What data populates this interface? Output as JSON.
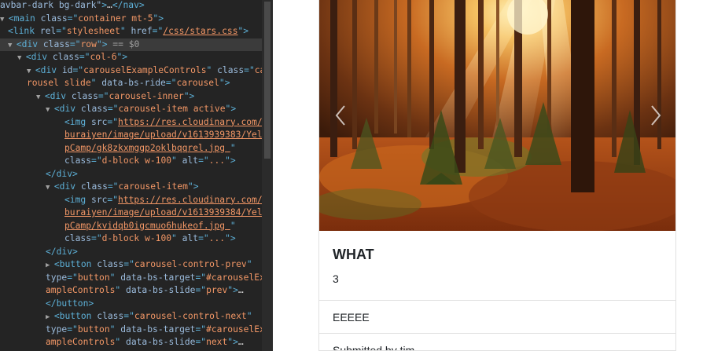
{
  "devtools": {
    "lines": [
      {
        "tokens": [
          [
            "attr",
            "avbar-dark bg-dark\""
          ],
          [
            "tag",
            ">"
          ],
          [
            "txt",
            "…"
          ],
          [
            "tag",
            "</nav>"
          ]
        ]
      },
      {
        "tri": "▼",
        "tokens": [
          [
            "tag",
            "<main "
          ],
          [
            "attr",
            "class"
          ],
          [
            "tag",
            "=\""
          ],
          [
            "val",
            "container mt-5"
          ],
          [
            "tag",
            "\">"
          ]
        ]
      },
      {
        "tokens": [
          [
            "tag",
            "<link "
          ],
          [
            "attr",
            "rel"
          ],
          [
            "tag",
            "=\""
          ],
          [
            "val",
            "stylesheet"
          ],
          [
            "tag",
            "\" "
          ],
          [
            "attr",
            "href"
          ],
          [
            "tag",
            "=\""
          ],
          [
            "link",
            "/css/stars.css"
          ],
          [
            "tag",
            "\">"
          ]
        ]
      },
      {
        "tri": "▼",
        "selected": true,
        "tokens": [
          [
            "tag",
            "<div "
          ],
          [
            "attr",
            "class"
          ],
          [
            "tag",
            "=\""
          ],
          [
            "val",
            "row"
          ],
          [
            "tag",
            "\">"
          ],
          [
            "dim",
            " == $0"
          ]
        ]
      },
      {
        "tri": "▼",
        "tokens": [
          [
            "tag",
            "<div "
          ],
          [
            "attr",
            "class"
          ],
          [
            "tag",
            "=\""
          ],
          [
            "val",
            "col-6"
          ],
          [
            "tag",
            "\">"
          ]
        ]
      },
      {
        "tri": "▼",
        "tokens": [
          [
            "tag",
            "<div "
          ],
          [
            "attr",
            "id"
          ],
          [
            "tag",
            "=\""
          ],
          [
            "val",
            "carouselExampleControls"
          ],
          [
            "tag",
            "\" "
          ],
          [
            "attr",
            "class"
          ],
          [
            "tag",
            "=\""
          ],
          [
            "val",
            "ca"
          ]
        ]
      },
      {
        "tokens": [
          [
            "val",
            "rousel slide"
          ],
          [
            "tag",
            "\" "
          ],
          [
            "attr",
            "data-bs-ride"
          ],
          [
            "tag",
            "=\""
          ],
          [
            "val",
            "carousel"
          ],
          [
            "tag",
            "\">"
          ]
        ]
      },
      {
        "tri": "▼",
        "tokens": [
          [
            "tag",
            "<div "
          ],
          [
            "attr",
            "class"
          ],
          [
            "tag",
            "=\""
          ],
          [
            "val",
            "carousel-inner"
          ],
          [
            "tag",
            "\">"
          ]
        ]
      },
      {
        "tri": "▼",
        "tokens": [
          [
            "tag",
            "<div "
          ],
          [
            "attr",
            "class"
          ],
          [
            "tag",
            "=\""
          ],
          [
            "val",
            "carousel-item active"
          ],
          [
            "tag",
            "\">"
          ]
        ]
      },
      {
        "tokens": [
          [
            "tag",
            "<img "
          ],
          [
            "attr",
            "src"
          ],
          [
            "tag",
            "=\""
          ],
          [
            "link",
            "https://res.cloudinary.com/"
          ]
        ]
      },
      {
        "tokens": [
          [
            "link",
            "buraiyen/image/upload/v1613939383/Yel"
          ]
        ]
      },
      {
        "tokens": [
          [
            "link",
            "pCamp/gk8zkxmggp2oklbqqrel.jpg "
          ],
          [
            "tag",
            "\""
          ]
        ]
      },
      {
        "tokens": [
          [
            "attr",
            "class"
          ],
          [
            "tag",
            "=\""
          ],
          [
            "val",
            "d-block w-100"
          ],
          [
            "tag",
            "\" "
          ],
          [
            "attr",
            "alt"
          ],
          [
            "tag",
            "=\""
          ],
          [
            "val",
            "..."
          ],
          [
            "tag",
            "\">"
          ]
        ]
      },
      {
        "tokens": [
          [
            "tag",
            "</div>"
          ]
        ]
      },
      {
        "tri": "▼",
        "tokens": [
          [
            "tag",
            "<div "
          ],
          [
            "attr",
            "class"
          ],
          [
            "tag",
            "=\""
          ],
          [
            "val",
            "carousel-item"
          ],
          [
            "tag",
            "\">"
          ]
        ]
      },
      {
        "tokens": [
          [
            "tag",
            "<img "
          ],
          [
            "attr",
            "src"
          ],
          [
            "tag",
            "=\""
          ],
          [
            "link",
            "https://res.cloudinary.com/"
          ]
        ]
      },
      {
        "tokens": [
          [
            "link",
            "buraiyen/image/upload/v1613939384/Yel"
          ]
        ]
      },
      {
        "tokens": [
          [
            "link",
            "pCamp/kvidqb0igcmuo6hukeof.jpg "
          ],
          [
            "tag",
            "\""
          ]
        ]
      },
      {
        "tokens": [
          [
            "attr",
            "class"
          ],
          [
            "tag",
            "=\""
          ],
          [
            "val",
            "d-block w-100"
          ],
          [
            "tag",
            "\" "
          ],
          [
            "attr",
            "alt"
          ],
          [
            "tag",
            "=\""
          ],
          [
            "val",
            "..."
          ],
          [
            "tag",
            "\">"
          ]
        ]
      },
      {
        "tokens": [
          [
            "tag",
            "</div>"
          ]
        ]
      },
      {
        "tri": "▶",
        "tokens": [
          [
            "tag",
            "<button "
          ],
          [
            "attr",
            "class"
          ],
          [
            "tag",
            "=\""
          ],
          [
            "val",
            "carousel-control-prev"
          ],
          [
            "tag",
            "\""
          ]
        ]
      },
      {
        "tokens": [
          [
            "attr",
            "type"
          ],
          [
            "tag",
            "=\""
          ],
          [
            "val",
            "button"
          ],
          [
            "tag",
            "\" "
          ],
          [
            "attr",
            "data-bs-target"
          ],
          [
            "tag",
            "=\""
          ],
          [
            "val",
            "#carouselEx"
          ]
        ]
      },
      {
        "tokens": [
          [
            "val",
            "ampleControls"
          ],
          [
            "tag",
            "\" "
          ],
          [
            "attr",
            "data-bs-slide"
          ],
          [
            "tag",
            "=\""
          ],
          [
            "val",
            "prev"
          ],
          [
            "tag",
            "\">"
          ],
          [
            "txt",
            "…"
          ]
        ]
      },
      {
        "tokens": [
          [
            "tag",
            "</button>"
          ]
        ]
      },
      {
        "tri": "▶",
        "tokens": [
          [
            "tag",
            "<button "
          ],
          [
            "attr",
            "class"
          ],
          [
            "tag",
            "=\""
          ],
          [
            "val",
            "carousel-control-next"
          ],
          [
            "tag",
            "\""
          ]
        ]
      },
      {
        "tokens": [
          [
            "attr",
            "type"
          ],
          [
            "tag",
            "=\""
          ],
          [
            "val",
            "button"
          ],
          [
            "tag",
            "\" "
          ],
          [
            "attr",
            "data-bs-target"
          ],
          [
            "tag",
            "=\""
          ],
          [
            "val",
            "#carouselEx"
          ]
        ]
      },
      {
        "tokens": [
          [
            "val",
            "ampleControls"
          ],
          [
            "tag",
            "\" "
          ],
          [
            "attr",
            "data-bs-slide"
          ],
          [
            "tag",
            "=\""
          ],
          [
            "val",
            "next"
          ],
          [
            "tag",
            "\">"
          ],
          [
            "txt",
            "…"
          ]
        ]
      }
    ]
  },
  "carousel": {
    "prev_icon": "chevron-left-icon",
    "next_icon": "chevron-right-icon"
  },
  "card": {
    "title": "WHAT",
    "text": "3",
    "list_items": [
      "EEEEE",
      "Submitted by tim"
    ]
  },
  "colors": {
    "devtools_bg": "#242424",
    "tag": "#5db0d7",
    "attr": "#9bbbdc",
    "value": "#f29766",
    "selected_row": "#3b3b3b"
  }
}
